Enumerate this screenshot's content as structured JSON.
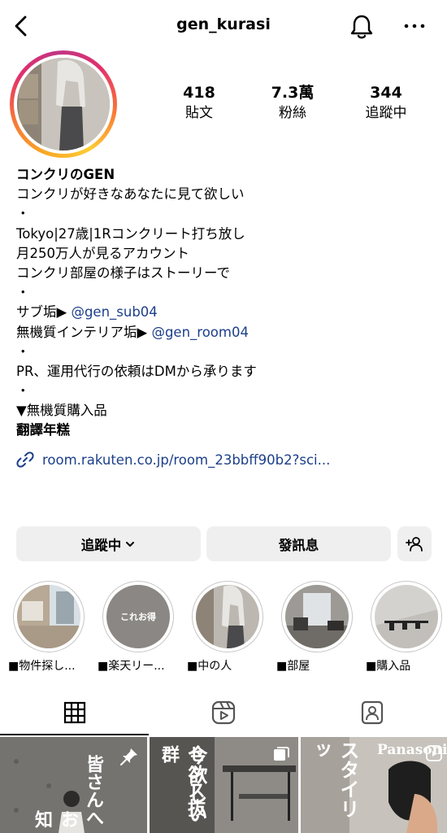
{
  "header": {
    "username": "gen_kurasi",
    "back_icon": "chevron-left-icon",
    "bell_icon": "bell-icon",
    "more_icon": "more-horizontal-icon"
  },
  "profile": {
    "stats": [
      {
        "value": "418",
        "label": "貼文"
      },
      {
        "value": "7.3萬",
        "label": "粉絲"
      },
      {
        "value": "344",
        "label": "追蹤中"
      }
    ],
    "name": "コンクリのGEN",
    "bio_lines": [
      "コンクリが好きなあなたに見て欲しい",
      "・",
      "Tokyo|27歳|1Rコンクリート打ち放し",
      "月250万人が見るアカウント",
      "コンクリ部屋の様子はストーリーで",
      "・"
    ],
    "sub_account": {
      "prefix": "サブ垢▶ ",
      "handle": "@gen_sub04"
    },
    "interior_account": {
      "prefix": "無機質インテリア垢▶ ",
      "handle": "@gen_room04"
    },
    "bio_lines_2": [
      "・",
      "PR、運用代行の依頼はDMから承ります",
      "・",
      "▼無機質購入品"
    ],
    "translate": "翻譯年糕",
    "link": "room.rakuten.co.jp/room_23bbff90b2?sci..."
  },
  "actions": {
    "following_label": "追蹤中",
    "message_label": "發訊息"
  },
  "highlights": [
    {
      "label": "■物件探し..."
    },
    {
      "label": "■楽天リー...",
      "cover_text": "これお得"
    },
    {
      "label": "■中の人"
    },
    {
      "label": "■部屋"
    },
    {
      "label": "■購入品"
    }
  ],
  "tabs": [
    {
      "name": "grid-icon",
      "active": true
    },
    {
      "name": "reels-icon",
      "active": false
    },
    {
      "name": "tagged-icon",
      "active": false
    }
  ],
  "posts": [
    {
      "text": "皆さんへ",
      "text2": "お知",
      "pinned": true
    },
    {
      "text": "今欲しい",
      "text2": "センス抜群",
      "multi": true
    },
    {
      "text": "スタイリッ",
      "brand": "Panasonic"
    }
  ]
}
